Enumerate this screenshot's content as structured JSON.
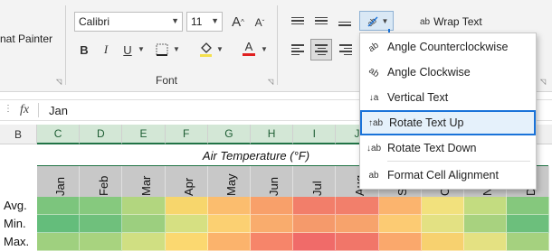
{
  "ribbon": {
    "format_painter_label": "nat Painter",
    "font_name": "Calibri",
    "font_size": "11",
    "grow_font": "A",
    "shrink_font": "A",
    "bold": "B",
    "italic": "I",
    "underline": "U",
    "font_color_letter": "A",
    "font_color": "#e02020",
    "font_group_label": "Font",
    "wrap_text_label": "Wrap Text",
    "wrap_icon_text": "ab"
  },
  "orientation_menu": {
    "items": [
      {
        "label": "Angle Counterclockwise",
        "icon": "angle-ccw-icon",
        "glyph": "ab"
      },
      {
        "label": "Angle Clockwise",
        "icon": "angle-cw-icon",
        "glyph": "ab"
      },
      {
        "label": "Vertical Text",
        "icon": "vertical-text-icon",
        "glyph": "↓a"
      },
      {
        "label": "Rotate Text Up",
        "icon": "rotate-up-icon",
        "glyph": "↑ab"
      },
      {
        "label": "Rotate Text Down",
        "icon": "rotate-down-icon",
        "glyph": "↓ab"
      },
      {
        "label": "Format Cell Alignment",
        "icon": "format-alignment-icon",
        "glyph": "ab"
      }
    ],
    "highlighted": "Rotate Text Up",
    "highlight_color": "#1a73d9"
  },
  "formula_bar": {
    "fx": "fx",
    "value": "Jan"
  },
  "columns": [
    "B",
    "C",
    "D",
    "E",
    "F",
    "G",
    "H",
    "I",
    "J",
    "K",
    "L",
    "M"
  ],
  "sheet": {
    "title": "Air Temperature (°F)",
    "months": [
      "Jan",
      "Feb",
      "Mar",
      "Apr",
      "May",
      "Jun",
      "Jul",
      "Aug",
      "Sep",
      "Oct",
      "Nov",
      "Dec"
    ],
    "row_labels": [
      "Avg.",
      "Min.",
      "Max."
    ],
    "heat_colors": [
      [
        "#7cc57d",
        "#86c97e",
        "#b2d67f",
        "#f7d66c",
        "#fbbd6e",
        "#f8a06a",
        "#f27e6a",
        "#f27f6b",
        "#fbb46e",
        "#f2e17d",
        "#c3dc80",
        "#85c87d"
      ],
      [
        "#64bd7b",
        "#6fc07c",
        "#9ccf7f",
        "#d6e082",
        "#fbd072",
        "#f9ac6d",
        "#f59a6b",
        "#f7a36c",
        "#fccb73",
        "#e3e183",
        "#a8d27f",
        "#6cbf7c"
      ],
      [
        "#9fd07f",
        "#a8d37f",
        "#d0df82",
        "#fbd870",
        "#fbb36c",
        "#f6856a",
        "#f06b69",
        "#f17669",
        "#faa86c",
        "#f7d16f",
        "#e4e182",
        "#a5d17f"
      ]
    ]
  }
}
